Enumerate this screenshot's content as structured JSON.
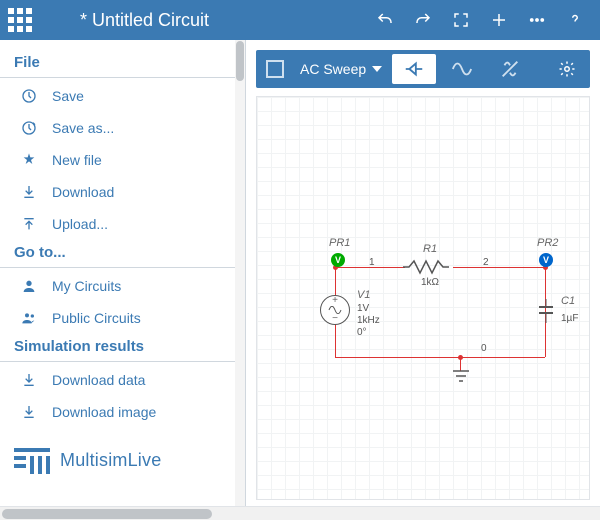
{
  "title": "* Untitled Circuit",
  "topbar": {
    "undo": "Undo",
    "redo": "Redo",
    "fullscreen": "Fullscreen",
    "add": "Add",
    "more": "More",
    "help": "Help"
  },
  "sidebar": {
    "sections": {
      "file": "File",
      "goto": "Go to...",
      "simresults": "Simulation results"
    },
    "items": {
      "save": "Save",
      "saveas": "Save as...",
      "newfile": "New file",
      "download": "Download",
      "upload": "Upload...",
      "mycircuits": "My Circuits",
      "publiccircuits": "Public Circuits",
      "dldata": "Download data",
      "dlimage": "Download image"
    }
  },
  "logo": "MultisimLive",
  "sim": {
    "mode_label": "AC Sweep"
  },
  "circuit": {
    "probe1": {
      "label": "PR1",
      "badge": "V"
    },
    "probe2": {
      "label": "PR2",
      "badge": "V"
    },
    "resistor": {
      "name": "R1",
      "value": "1kΩ"
    },
    "source": {
      "name": "V1",
      "amplitude": "1V",
      "freq": "1kHz",
      "phase": "0°"
    },
    "cap": {
      "name": "C1",
      "value": "1µF"
    },
    "nodes": {
      "n1": "1",
      "n2": "2",
      "n0": "0"
    }
  }
}
